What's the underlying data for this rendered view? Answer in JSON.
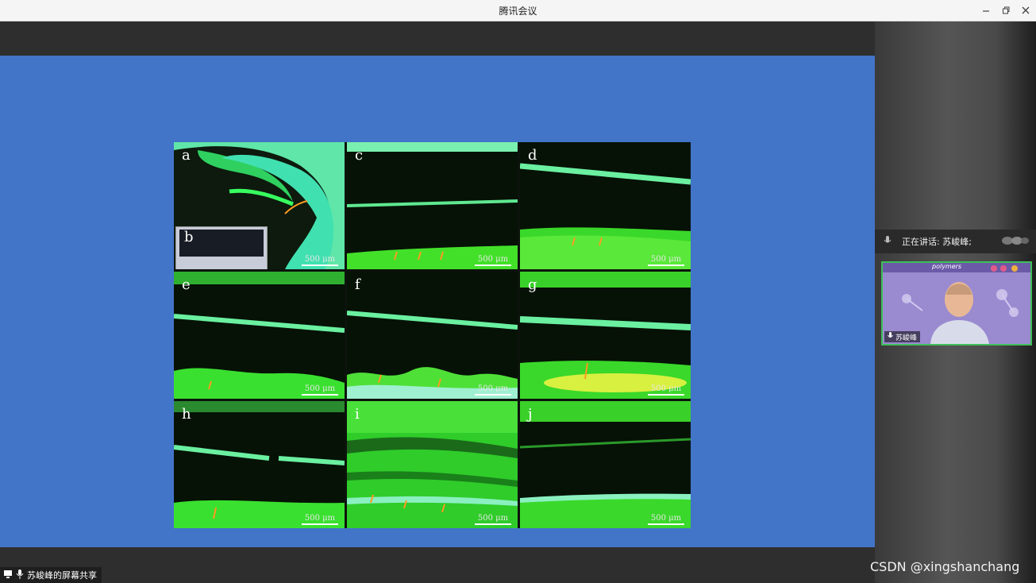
{
  "window": {
    "title": "腾讯会议",
    "minimize_icon": "minimize-icon",
    "restore_icon": "restore-icon",
    "close_icon": "close-icon"
  },
  "figure": {
    "panels": [
      {
        "label": "a",
        "scale": "500 μm"
      },
      {
        "label": "b",
        "scale": ""
      },
      {
        "label": "c",
        "scale": "500 μm"
      },
      {
        "label": "d",
        "scale": "500 μm"
      },
      {
        "label": "e",
        "scale": "500 μm"
      },
      {
        "label": "f",
        "scale": "500 μm"
      },
      {
        "label": "g",
        "scale": "500 μm"
      },
      {
        "label": "h",
        "scale": "500 μm"
      },
      {
        "label": "i",
        "scale": "500 μm"
      },
      {
        "label": "j",
        "scale": "500 μm"
      }
    ]
  },
  "sidebar": {
    "speaking_label": "正在讲话: 苏峻峰;",
    "participant_name": "苏峻峰",
    "video_banner": "polymers"
  },
  "share": {
    "label": "苏峻峰的屏幕共享"
  },
  "watermark": "CSDN @xingshanchang"
}
